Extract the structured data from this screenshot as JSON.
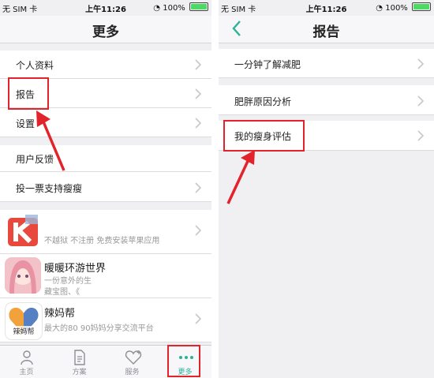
{
  "status": {
    "carrier": "无 SIM 卡",
    "time": "上午11:26",
    "battery": "100%"
  },
  "left": {
    "title": "更多",
    "rows": [
      {
        "label": "个人资料"
      },
      {
        "label": "报告"
      },
      {
        "label": "设置"
      }
    ],
    "feedback_label": "用户反馈",
    "vote_label": "投一票支持瘦瘦",
    "apps": [
      {
        "title": "",
        "desc": "不越狱 不注册 免费安装苹果应用"
      },
      {
        "title": "暖暖环游世界",
        "desc": "一份意外的生",
        "desc2": "藏宝图、《"
      },
      {
        "title": "辣妈帮",
        "desc": "最大的80 90妈妈分享交流平台",
        "icon_text": "辣妈帮"
      }
    ],
    "tabs": [
      {
        "label": "主页"
      },
      {
        "label": "方案"
      },
      {
        "label": "服务"
      },
      {
        "label": "更多"
      }
    ]
  },
  "right": {
    "title": "报告",
    "rows": [
      {
        "label": "一分钟了解减肥"
      },
      {
        "label": "肥胖原因分析"
      },
      {
        "label": "我的瘦身评估"
      }
    ]
  },
  "colors": {
    "accent": "#2bb39a",
    "highlight": "#e2232c",
    "background": "#f0f0f2"
  }
}
